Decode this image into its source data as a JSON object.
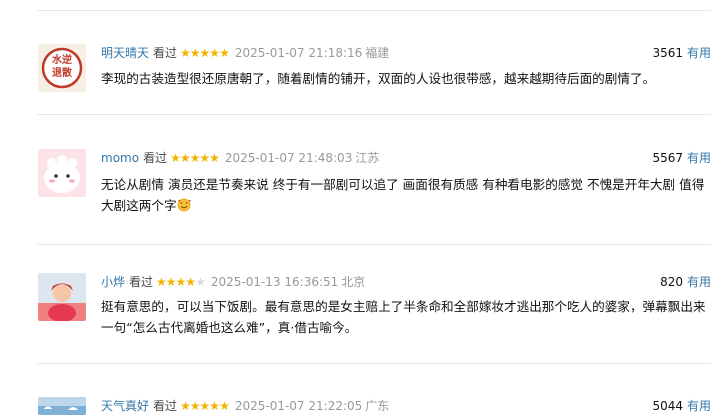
{
  "comments": [
    {
      "user": "明天晴天",
      "status": "看过",
      "rating": 5,
      "time": "2025-01-07 21:18:16",
      "location": "福建",
      "votes": "3561",
      "useful_label": "有用",
      "avatar_text": [
        "水逆",
        "退散"
      ],
      "content": "李现的古装造型很还原唐朝了，随着剧情的铺开，双面的人设也很带感，越来越期待后面的剧情了。"
    },
    {
      "user": "momo",
      "status": "看过",
      "rating": 5,
      "time": "2025-01-07 21:48:03",
      "location": "江苏",
      "votes": "5567",
      "useful_label": "有用",
      "content": "无论从剧情 演员还是节奏来说 终于有一部剧可以追了 画面很有质感 有种看电影的感觉 不愧是开年大剧 值得大剧这两个字",
      "content_emoji": "smiling-face-with-hearts"
    },
    {
      "user": "小烨",
      "status": "看过",
      "rating": 4,
      "time": "2025-01-13 16:36:51",
      "location": "北京",
      "votes": "820",
      "useful_label": "有用",
      "content": "挺有意思的，可以当下饭剧。最有意思的是女主赔上了半条命和全部嫁妆才逃出那个吃人的婆家，弹幕飘出来一句“怎么古代离婚也这么难”，真·借古喻今。"
    },
    {
      "user": "天气真好",
      "status": "看过",
      "rating": 5,
      "time": "2025-01-07 21:22:05",
      "location": "广东",
      "votes": "5044",
      "useful_label": "有用"
    }
  ],
  "colors": {
    "link": "#3377aa",
    "star": "#f4b400",
    "meta": "#999999",
    "divider": "#e8e8e8"
  }
}
